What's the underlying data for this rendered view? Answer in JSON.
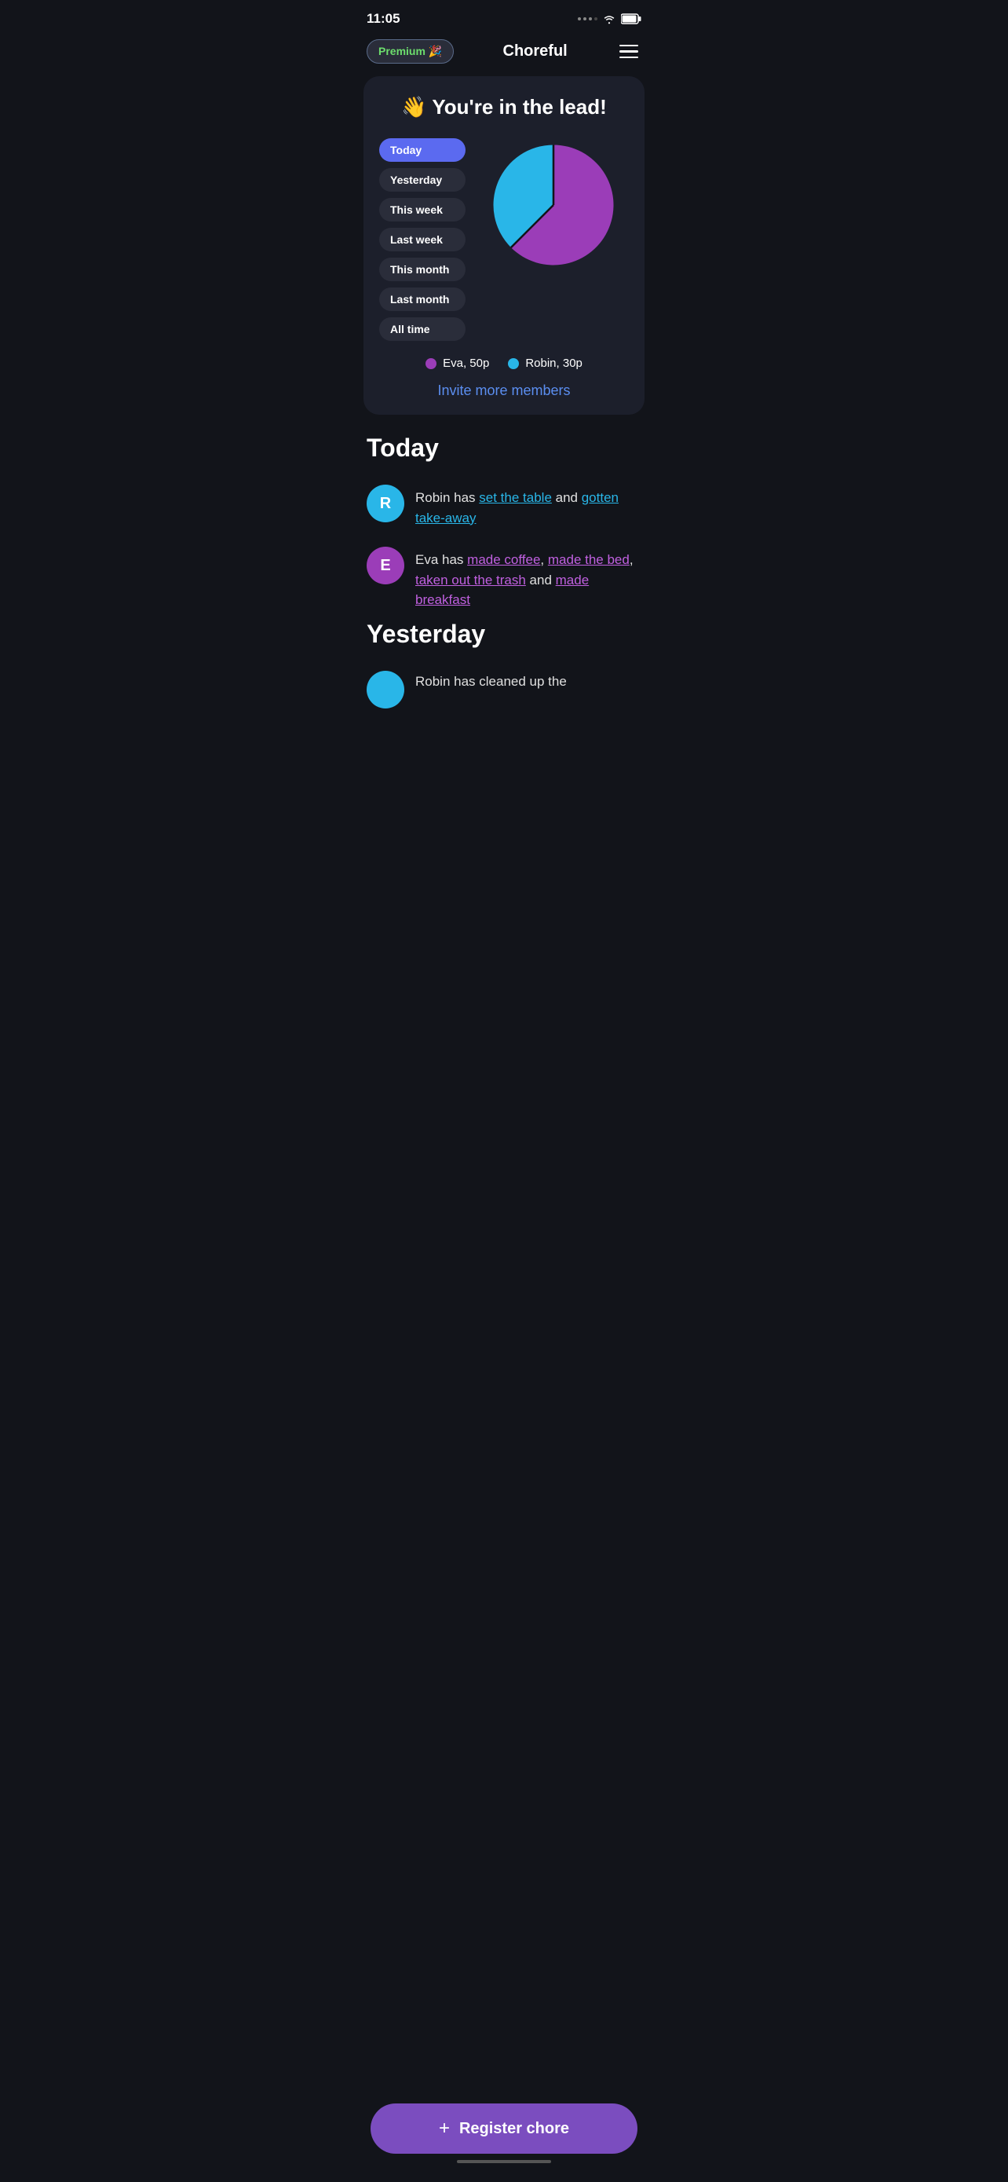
{
  "statusBar": {
    "time": "11:05"
  },
  "nav": {
    "premiumLabel": "Premium 🎉",
    "title": "Choreful",
    "menuAriaLabel": "Menu"
  },
  "leaderboard": {
    "emoji": "👋",
    "title": "You're in the lead!",
    "filters": [
      {
        "label": "Today",
        "active": true
      },
      {
        "label": "Yesterday",
        "active": false
      },
      {
        "label": "This week",
        "active": false
      },
      {
        "label": "Last week",
        "active": false
      },
      {
        "label": "This month",
        "active": false
      },
      {
        "label": "Last month",
        "active": false
      },
      {
        "label": "All time",
        "active": false
      }
    ],
    "legend": [
      {
        "name": "Eva",
        "points": "50p",
        "color": "#9b3db8"
      },
      {
        "name": "Robin",
        "points": "30p",
        "color": "#29b6e8"
      }
    ],
    "inviteLabel": "Invite more members"
  },
  "todaySection": {
    "title": "Today",
    "items": [
      {
        "user": "Robin",
        "avatarLetter": "R",
        "avatarClass": "avatar-robin",
        "chores": [
          "set the table",
          "gotten take-away"
        ],
        "textParts": [
          "Robin has ",
          " and ",
          ""
        ]
      },
      {
        "user": "Eva",
        "avatarLetter": "E",
        "avatarClass": "avatar-eva",
        "chores": [
          "made coffee",
          "made the bed",
          "taken out the trash",
          "made breakfast"
        ],
        "textParts": [
          "Eva has ",
          ", ",
          ", ",
          " and ",
          ""
        ]
      }
    ]
  },
  "yesterdaySection": {
    "title": "Yesterday",
    "partialText": "Robin has cleaned up the"
  },
  "registerBtn": {
    "label": "Register chore",
    "plus": "+"
  }
}
